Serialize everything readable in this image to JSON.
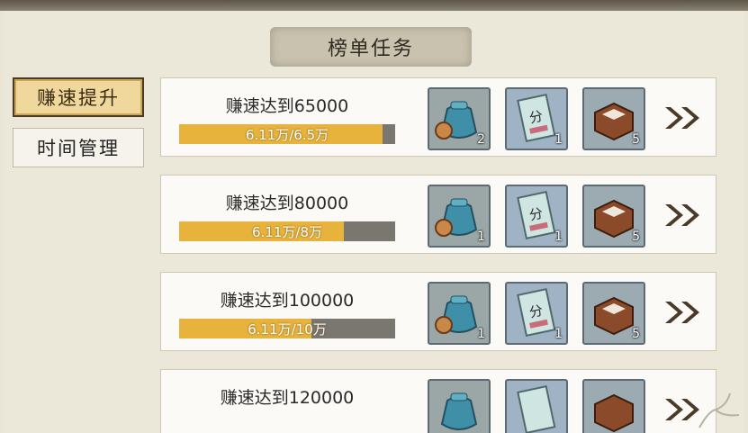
{
  "header": {
    "title": "榜单任务"
  },
  "tabs": [
    {
      "label": "赚速提升",
      "active": true
    },
    {
      "label": "时间管理",
      "active": false
    }
  ],
  "tasks": [
    {
      "title": "赚速达到65000",
      "progress_text": "6.11万/6.5万",
      "progress_fraction": 0.94,
      "rewards": [
        {
          "icon": "coin-bag-icon",
          "count": "2"
        },
        {
          "icon": "score-ticket-icon",
          "count": "1"
        },
        {
          "icon": "box-icon",
          "count": "5"
        }
      ]
    },
    {
      "title": "赚速达到80000",
      "progress_text": "6.11万/8万",
      "progress_fraction": 0.7637,
      "rewards": [
        {
          "icon": "coin-bag-icon",
          "count": "1"
        },
        {
          "icon": "score-ticket-icon",
          "count": "1"
        },
        {
          "icon": "box-icon",
          "count": "5"
        }
      ]
    },
    {
      "title": "赚速达到100000",
      "progress_text": "6.11万/10万",
      "progress_fraction": 0.611,
      "rewards": [
        {
          "icon": "coin-bag-icon",
          "count": "1"
        },
        {
          "icon": "score-ticket-icon",
          "count": "1"
        },
        {
          "icon": "box-icon",
          "count": "5"
        }
      ]
    },
    {
      "title": "赚速达到120000",
      "progress_text": "",
      "progress_fraction": null,
      "rewards": [
        {
          "icon": "coin-bag-icon",
          "count": ""
        },
        {
          "icon": "score-ticket-icon",
          "count": ""
        },
        {
          "icon": "box-icon",
          "count": ""
        }
      ]
    }
  ],
  "colors": {
    "accent": "#e8b33c",
    "bar_bg": "#7a7670",
    "panel_bg": "#ece8d9",
    "active_tab": "#f0d89c"
  }
}
